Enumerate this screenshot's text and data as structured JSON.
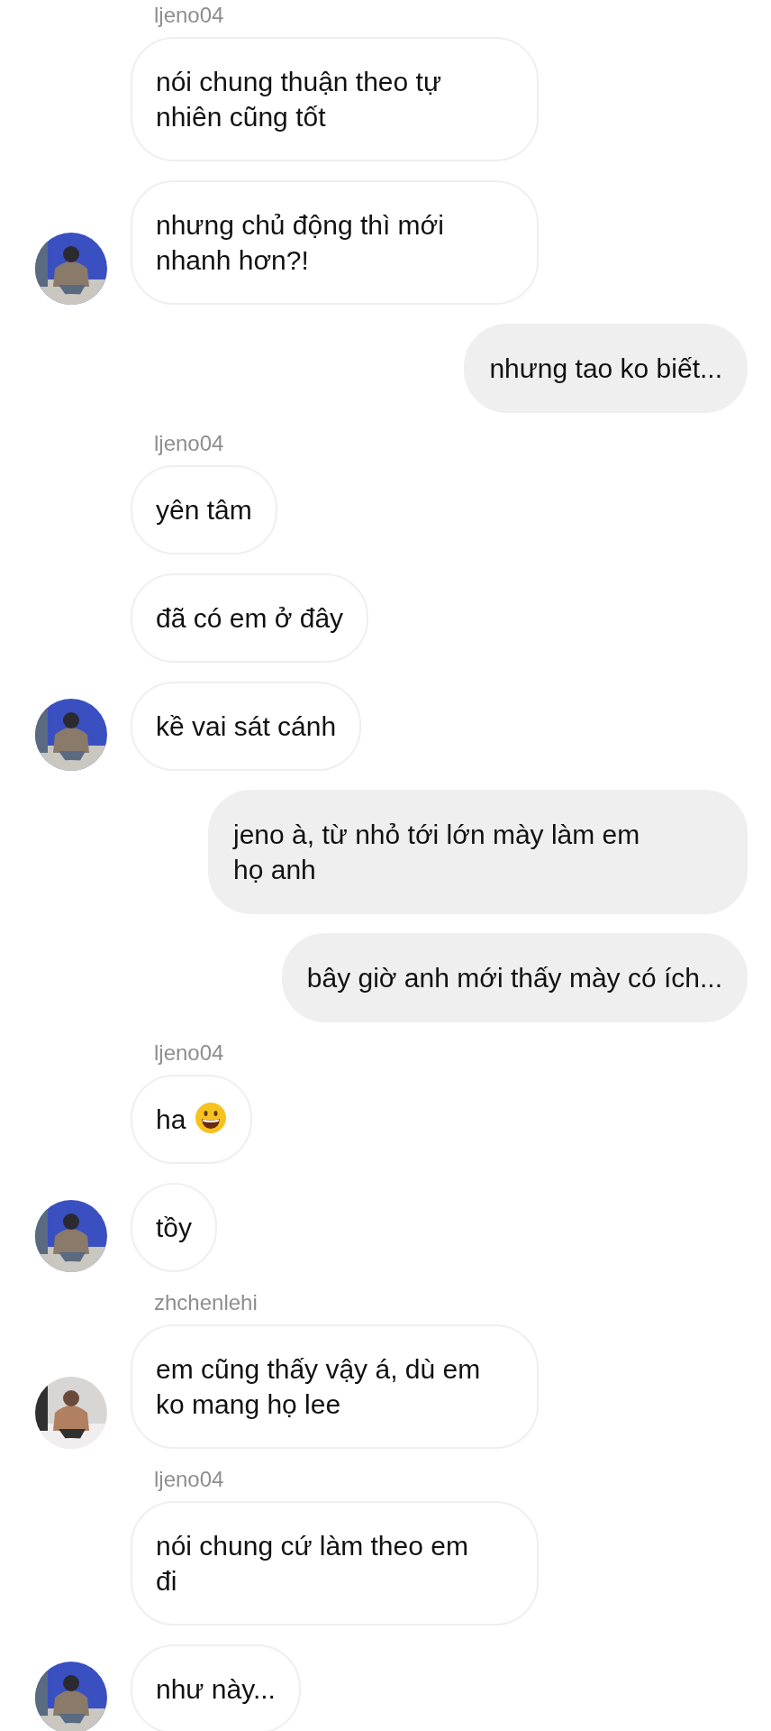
{
  "thread": [
    {
      "kind": "username",
      "text": "ljeno04"
    },
    {
      "kind": "incoming",
      "lines": [
        "nói chung thuận theo tự",
        "nhiên cũng tốt"
      ]
    },
    {
      "kind": "incoming",
      "lines": [
        "nhưng chủ động thì mới",
        "nhanh hơn?!"
      ],
      "avatar": {
        "kind": "picture"
      }
    },
    {
      "kind": "outgoing",
      "lines": [
        "nhưng tao ko biết..."
      ]
    },
    {
      "kind": "username",
      "text": "ljeno04"
    },
    {
      "kind": "incoming",
      "lines": [
        "yên tâm"
      ]
    },
    {
      "kind": "incoming",
      "lines": [
        "đã có em ở đây"
      ]
    },
    {
      "kind": "incoming",
      "lines": [
        "kề vai sát cánh"
      ],
      "avatar": {
        "kind": "picture"
      }
    },
    {
      "kind": "outgoing",
      "lines": [
        "jeno à, từ nhỏ tới lớn mày làm em",
        "họ anh"
      ]
    },
    {
      "kind": "outgoing",
      "lines": [
        "bây giờ anh mới thấy mày có ích..."
      ]
    },
    {
      "kind": "username",
      "text": "ljeno04"
    },
    {
      "kind": "incoming_emoji",
      "lines": [
        "ha"
      ]
    },
    {
      "kind": "incoming",
      "lines": [
        "tồy"
      ],
      "avatar": {
        "kind": "picture"
      }
    },
    {
      "kind": "username",
      "text": "zhchenlehi"
    },
    {
      "kind": "incoming",
      "lines": [
        "em cũng thấy vậy á, dù em",
        "ko mang họ lee"
      ],
      "avatar": {
        "kind": "picture"
      }
    },
    {
      "kind": "username",
      "text": "ljeno04"
    },
    {
      "kind": "incoming",
      "lines": [
        "nói chung cứ làm theo em",
        "đi"
      ]
    },
    {
      "kind": "incoming",
      "lines": [
        "như này..."
      ],
      "avatar": {
        "kind": "picture"
      }
    }
  ]
}
